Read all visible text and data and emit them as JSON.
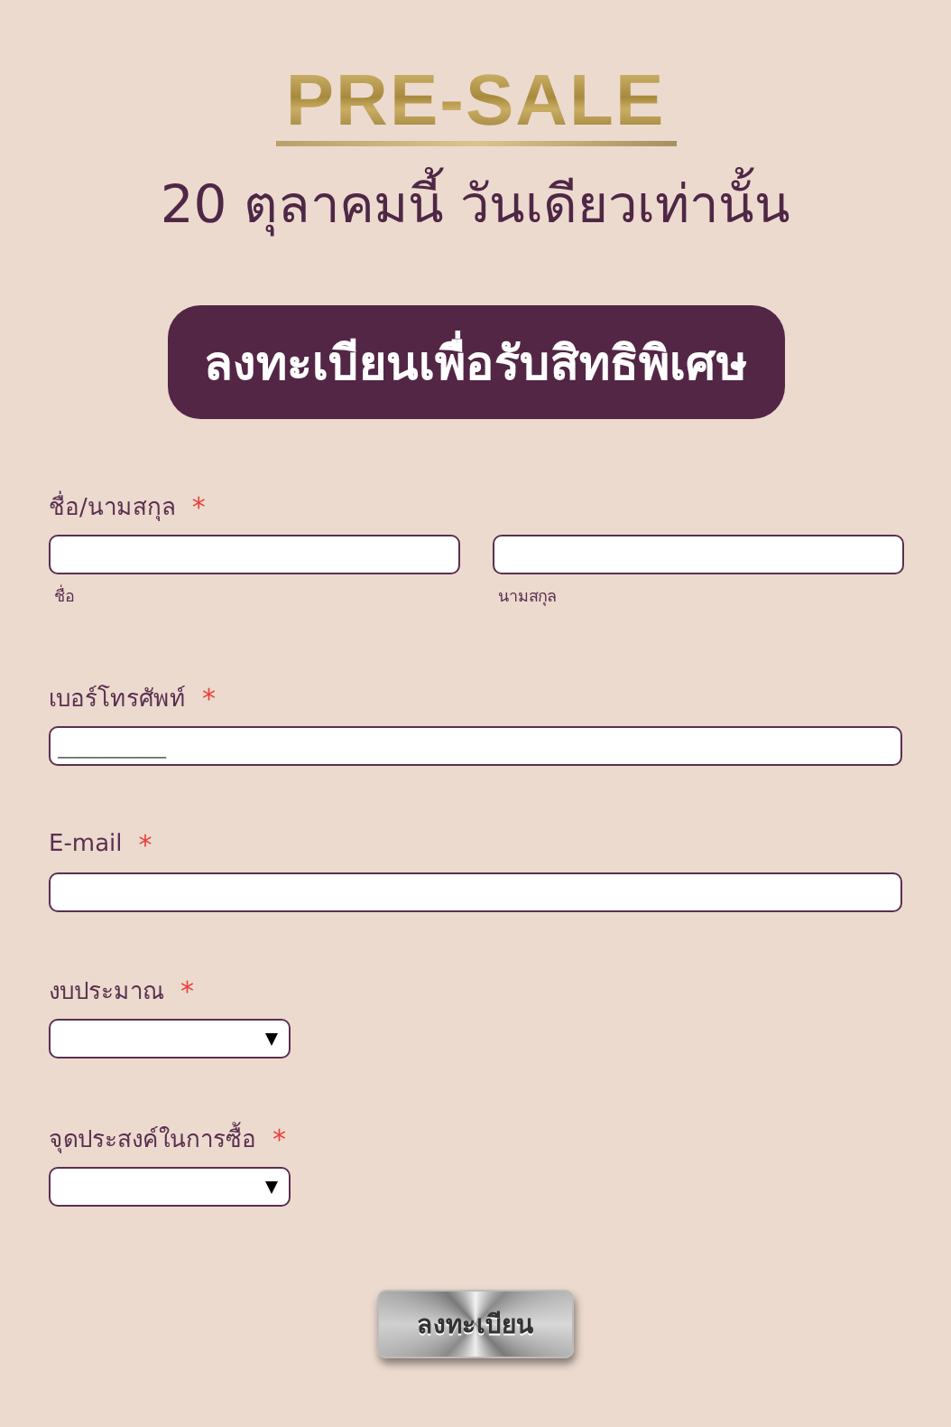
{
  "header": {
    "title": "PRE-SALE",
    "subtitle": "20 ตุลาคมนี้ วันเดียวเท่านั้น",
    "banner_button": "ลงทะเบียนเพื่อรับสิทธิพิเศษ"
  },
  "form": {
    "required_mark": "*",
    "fields": [
      {
        "kind": "name_pair",
        "label": "ชื่อ/นามสกุล",
        "required": true,
        "sublabels": [
          "ชื่อ",
          "นามสกุล"
        ]
      },
      {
        "kind": "text",
        "label": "เบอร์โทรศัพท์",
        "required": true,
        "placeholder": "__________"
      },
      {
        "kind": "text",
        "label": "E-mail",
        "required": true
      },
      {
        "kind": "select",
        "label": "งบประมาณ",
        "required": true
      },
      {
        "kind": "select",
        "label": "จุดประสงค์ในการซื้อ",
        "required": true
      }
    ],
    "submit": "ลงทะเบียน"
  }
}
